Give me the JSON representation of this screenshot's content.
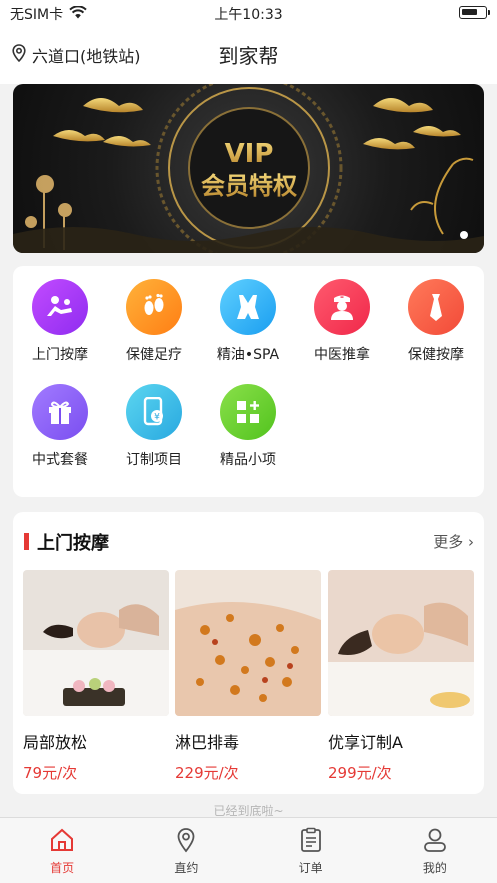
{
  "status_bar": {
    "carrier": "无SIM卡",
    "time": "上午10:33"
  },
  "header": {
    "location": "六道口(地铁站)",
    "title": "到家帮"
  },
  "banner": {
    "line1": "VIP",
    "line2": "会员特权"
  },
  "categories": [
    {
      "label": "上门按摩",
      "icon": "massage-icon",
      "color_from": "#c24bff",
      "color_to": "#8f2cf0"
    },
    {
      "label": "保健足疗",
      "icon": "footprints-icon",
      "color_from": "#ffb23a",
      "color_to": "#ff7e14"
    },
    {
      "label": "精油•SPA",
      "icon": "swimsuit-icon",
      "color_from": "#5fd0ff",
      "color_to": "#1a9ef0"
    },
    {
      "label": "中医推拿",
      "icon": "doctor-icon",
      "color_from": "#ff5a6e",
      "color_to": "#f0284a"
    },
    {
      "label": "保健按摩",
      "icon": "tie-icon",
      "color_from": "#ff7a5a",
      "color_to": "#f24a38"
    },
    {
      "label": "中式套餐",
      "icon": "gift-icon",
      "color_from": "#a27bff",
      "color_to": "#7a4ef0"
    },
    {
      "label": "订制项目",
      "icon": "phone-yen-icon",
      "color_from": "#5cd6f0",
      "color_to": "#28a8e0"
    },
    {
      "label": "精品小项",
      "icon": "grid-plus-icon",
      "color_from": "#8ae04a",
      "color_to": "#52c31e"
    }
  ],
  "section": {
    "title": "上门按摩",
    "more": "更多",
    "items": [
      {
        "name": "局部放松",
        "price": "79元/次"
      },
      {
        "name": "淋巴排毒",
        "price": "229元/次"
      },
      {
        "name": "优享订制A",
        "price": "299元/次"
      }
    ]
  },
  "end_note": "已经到底啦~",
  "tabs": [
    {
      "label": "首页",
      "icon": "home-icon",
      "active": true
    },
    {
      "label": "直约",
      "icon": "location-pin-icon",
      "active": false
    },
    {
      "label": "订单",
      "icon": "clipboard-icon",
      "active": false
    },
    {
      "label": "我的",
      "icon": "user-icon",
      "active": false
    }
  ],
  "colors": {
    "accent": "#e53935",
    "gold": "#d9b44a"
  }
}
